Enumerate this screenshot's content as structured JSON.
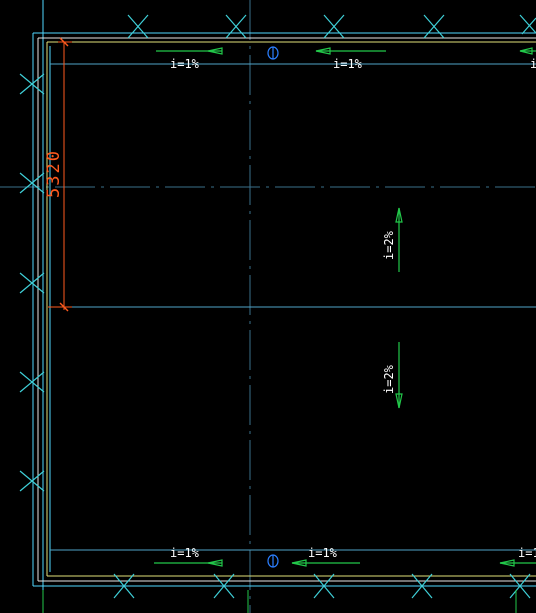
{
  "drawing": {
    "background_color": "#000000",
    "colors": {
      "building_outline": "#4fd8ff",
      "inner_outline": "#e6e6e6",
      "slab_edge": "#e2e27a",
      "axis_line": "#3a6f8a",
      "grid_line": "#4fa3c7",
      "column_marker": "#3fd0d8",
      "green_line": "#22c84a",
      "dimension": "#ff5a1e",
      "label_text": "#ffffff",
      "drain_symbol": "#2b7fff"
    },
    "dimension_label": "5320",
    "slope_labels": {
      "top_left": "i=1%",
      "top_middle": "i=1%",
      "top_right": "i",
      "middle_upper": "i=2%",
      "middle_lower": "i=2%",
      "bottom_left": "i=1%",
      "bottom_middle": "i=1%",
      "bottom_right": "i=1"
    },
    "drain_symbols": {
      "top": "drain-symbol-icon",
      "bottom": "drain-symbol-icon"
    },
    "icons": {
      "column_marker": "x-cross-icon",
      "slope_arrow": "arrow-icon",
      "dimension_tick": "dimension-tick-icon"
    }
  }
}
